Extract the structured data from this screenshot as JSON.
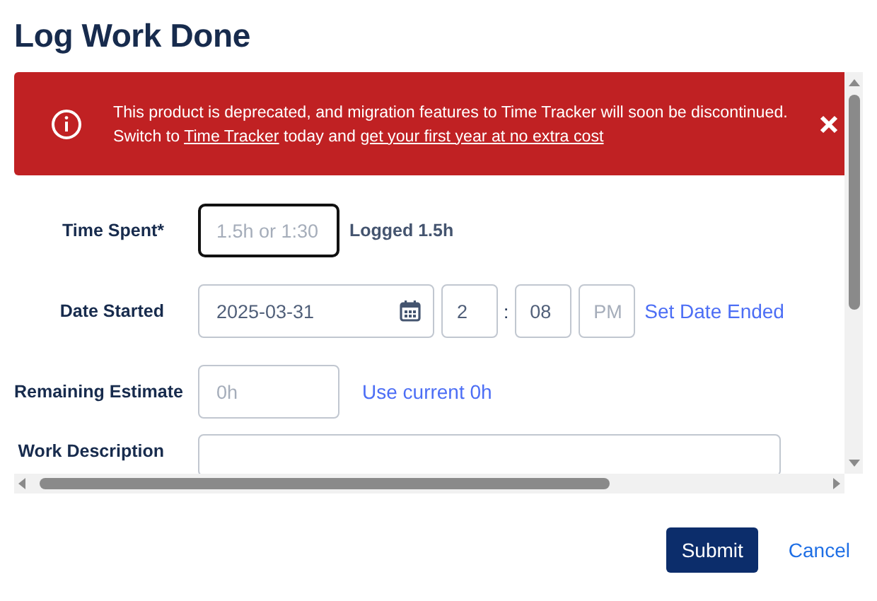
{
  "title": "Log Work Done",
  "banner": {
    "message": "This product is deprecated, and migration features to Time Tracker will soon be discontinued.",
    "line2_prefix": "Switch to",
    "link1": "Time Tracker",
    "middle": "today and",
    "link2": "get your first year at no extra cost"
  },
  "form": {
    "time_spent": {
      "label": "Time Spent*",
      "placeholder": "1.5h or 1:30",
      "focused": true,
      "logged": "Logged 1.5h"
    },
    "date_started": {
      "label": "Date Started",
      "date": "2025-03-31",
      "hour": "2",
      "separator": ":",
      "minute": "08",
      "ampm": "PM",
      "link": "Set Date Ended"
    },
    "remaining_estimate": {
      "label": "Remaining Estimate",
      "placeholder": "0h",
      "link": "Use current 0h"
    },
    "work_description": {
      "label": "Work Description"
    }
  },
  "buttons": {
    "submit": "Submit",
    "cancel": "Cancel"
  }
}
